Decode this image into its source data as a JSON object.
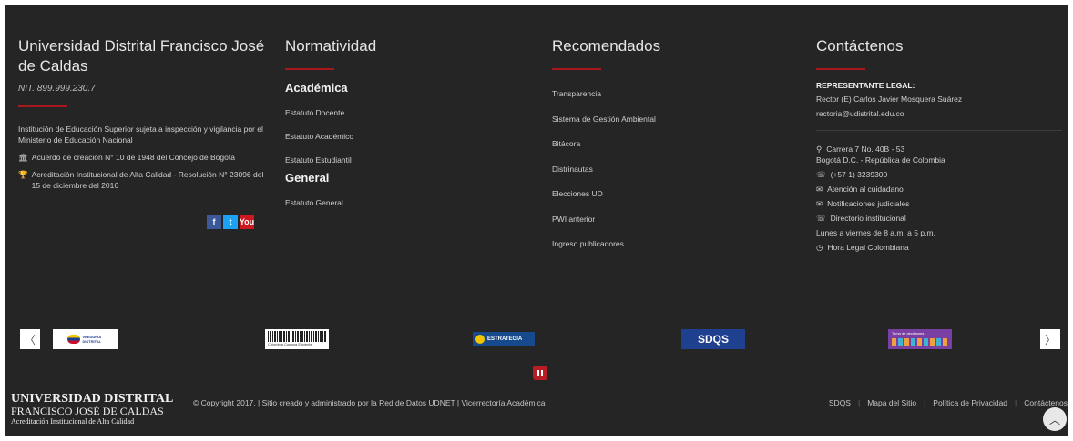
{
  "university": {
    "name": "Universidad Distrital Francisco José de Caldas",
    "nit": "NIT. 899.999.230.7",
    "description": "Institución de Educación Superior sujeta a inspección y vigilancia por el Ministerio de Educación Nacional",
    "creation": "Acuerdo de creación N° 10 de 1948 del Concejo de Bogotá",
    "accreditation": "Acreditación Institucional de Alta Calidad - Resolución N° 23096 del 15 de diciembre del 2016"
  },
  "social": {
    "facebook": "f",
    "twitter": "t",
    "youtube": "You"
  },
  "normatividad": {
    "title": "Normatividad",
    "academica_title": "Académica",
    "academica": [
      "Estatuto Docente",
      "Estatuto Académico",
      "Estatuto Estudiantil"
    ],
    "general_title": "General",
    "general": [
      "Estatuto General"
    ]
  },
  "recomendados": {
    "title": "Recomendados",
    "items": [
      "Transparencia",
      "Sistema de Gestión Ambiental",
      "Bitácora",
      "Distrinautas",
      "Elecciones UD",
      "PWI anterior",
      "Ingreso publicadores"
    ]
  },
  "contacto": {
    "title": "Contáctenos",
    "legal_label": "REPRESENTANTE LEGAL:",
    "rector": "Rector (E) Carlos Javier Mosquera Suárez",
    "email": "rectoria@udistrital.edu.co",
    "address1": "Carrera 7 No. 40B - 53",
    "address2": "Bogotá D.C. - República de Colombia",
    "phone": "(+57 1) 3239300",
    "atencion": "Atención al cuidadano",
    "notificaciones": "Notificaciones judiciales",
    "directorio": "Directorio institucional",
    "horario": "Lunes a viernes de 8 a.m. a 5 p.m.",
    "hora_legal": "Hora Legal Colombiana"
  },
  "carousel": {
    "prev": "〈",
    "next": "〉",
    "logos": [
      "VEEDURÍA DISTRITAL",
      "Colombia Compra Eficiente",
      "ESTRATEGIA",
      "SDQS",
      "Toma de decisiones"
    ]
  },
  "bottom": {
    "ud_line1": "UNIVERSIDAD DISTRITAL",
    "ud_line2": "FRANCISCO JOSÉ DE CALDAS",
    "ud_line3": "Acreditación Institucional de Alta Calidad",
    "copyright": "© Copyright 2017. | Sitio creado y administrado por la Red de Datos UDNET | Vicerrectoría Académica",
    "links": [
      "SDQS",
      "Mapa del Sitio",
      "Política de Privacidad",
      "Contáctenos"
    ]
  },
  "colors": {
    "background": "#252525",
    "accent": "#a8181d"
  }
}
